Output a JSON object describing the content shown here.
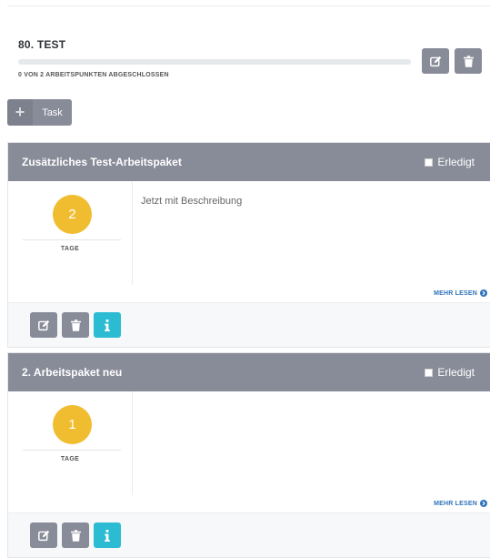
{
  "project": {
    "title": "80. TEST",
    "progress_text": "0 VON 2 ARBEITSPUNKTEN ABGESCHLOSSEN",
    "progress_fraction": 0
  },
  "toolbar": {
    "add_task_label": "Task",
    "edit_icon": "edit-icon",
    "delete_icon": "trash-icon"
  },
  "tasks": [
    {
      "title": "Zusätzliches Test-Arbeitspaket",
      "done_label": "Erledigt",
      "done": false,
      "days": "2",
      "days_label": "TAGE",
      "description": "Jetzt mit Beschreibung",
      "more_label": "MEHR LESEN"
    },
    {
      "title": "2. Arbeitspaket neu",
      "done_label": "Erledigt",
      "done": false,
      "days": "1",
      "days_label": "TAGE",
      "description": "",
      "more_label": "MEHR LESEN"
    }
  ],
  "colors": {
    "header_bg": "#888b98",
    "badge": "#f1bd30",
    "info_button": "#2bbcd3",
    "link": "#2f73b8"
  }
}
